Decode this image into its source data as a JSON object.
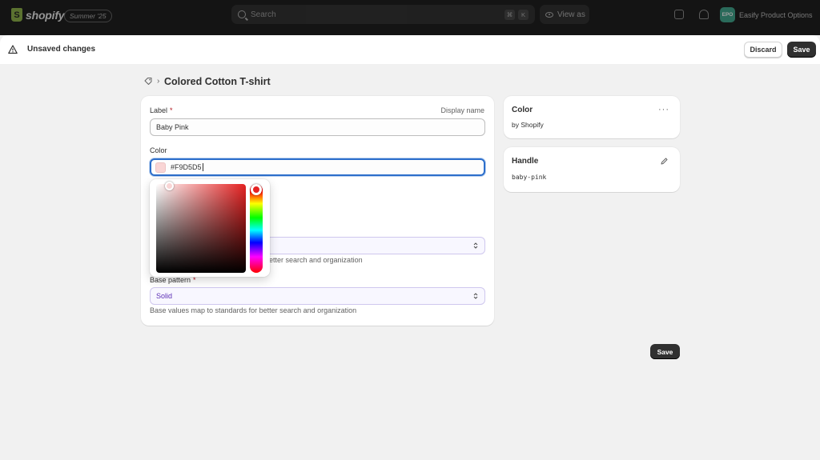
{
  "topbar": {
    "logo_text": "shopify",
    "season_badge": "Summer '25",
    "search_placeholder": "Search",
    "search_shortcut": [
      "⌘",
      "K"
    ],
    "view_as_label": "View as",
    "store_avatar": "EPO",
    "store_name": "Easify Product Options"
  },
  "savebar": {
    "message": "Unsaved changes",
    "discard_label": "Discard",
    "save_label": "Save"
  },
  "page": {
    "title": "Colored Cotton T-shirt"
  },
  "form": {
    "label_field": {
      "label": "Label",
      "required": "*",
      "aside": "Display name",
      "value": "Baby Pink"
    },
    "color_field": {
      "label": "Color",
      "value": "#F9D5D5"
    },
    "hidden_select": {
      "helper": "etter search and organization"
    },
    "base_pattern": {
      "label": "Base pattern",
      "required": "*",
      "value": "Solid",
      "helper": "Base values map to standards for better search and organization"
    }
  },
  "color_card": {
    "title": "Color",
    "subtitle": "by Shopify",
    "more_label": "···"
  },
  "handle_card": {
    "title": "Handle",
    "value": "baby-pink"
  },
  "footer": {
    "save_label": "Save"
  },
  "colors": {
    "selected_color": "#F9D5D5",
    "accent_focus": "#2c6ecb",
    "primary_button": "#303030"
  }
}
